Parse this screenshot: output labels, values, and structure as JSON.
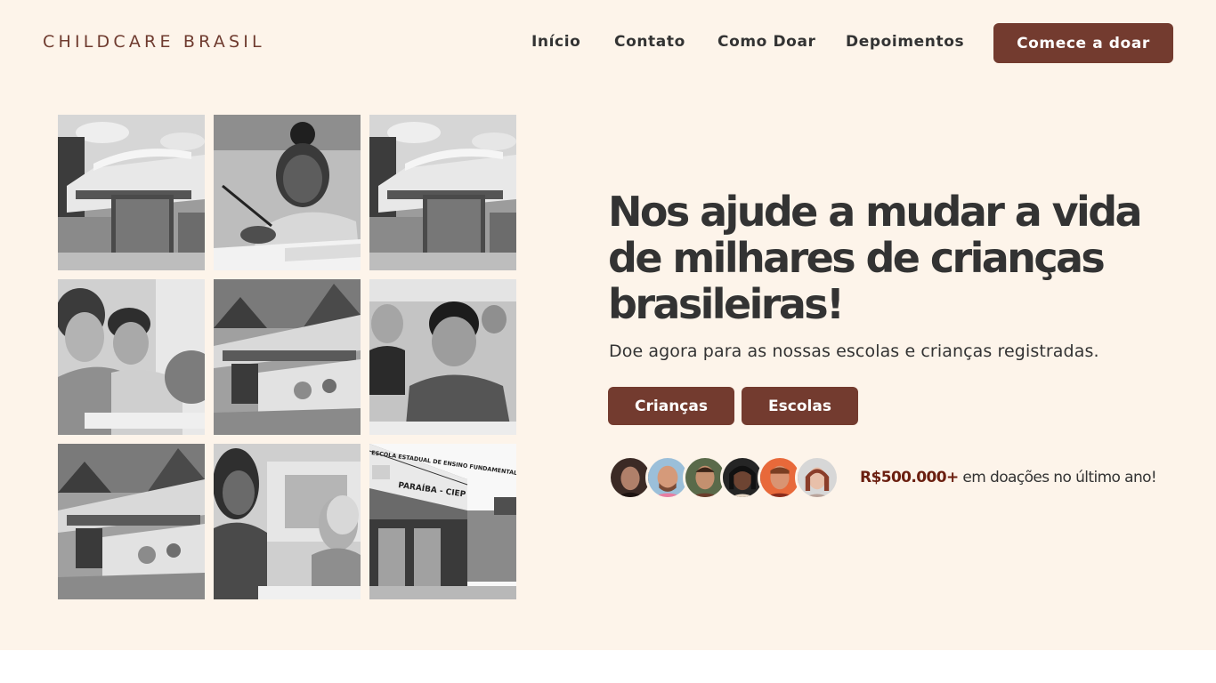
{
  "header": {
    "logo": "CHILDCARE BRASIL",
    "nav": [
      "Início",
      "Contato",
      "Como Doar",
      "Depoimentos"
    ],
    "cta_label": "Comece a doar"
  },
  "hero": {
    "headline": "Nos ajude a mudar a vida de milhares de crianças brasileiras!",
    "subtitle": "Doe agora para as nossas escolas e crianças registradas.",
    "buttons": [
      "Crianças",
      "Escolas"
    ],
    "stat_highlight": "R$500.000+",
    "stat_text": " em doações no último ano!"
  },
  "gallery": {
    "photos": [
      "school-building-photo",
      "girl-writing-photo",
      "school-building-photo",
      "children-with-globe-photo",
      "school-with-murals-photo",
      "boy-in-classroom-photo",
      "school-with-murals-photo",
      "teacher-with-student-photo",
      "paraiba-ciep-school-photo"
    ],
    "sign_text": [
      "ESCOLA ESTADUAL DE ENSINO FUNDAMENTAL",
      "PARAÍBA - CIEP"
    ]
  },
  "donors": {
    "count": 6
  },
  "colors": {
    "background": "#fdf4ea",
    "accent": "#733b2f",
    "highlight": "#6b1f10",
    "text": "#333333"
  }
}
